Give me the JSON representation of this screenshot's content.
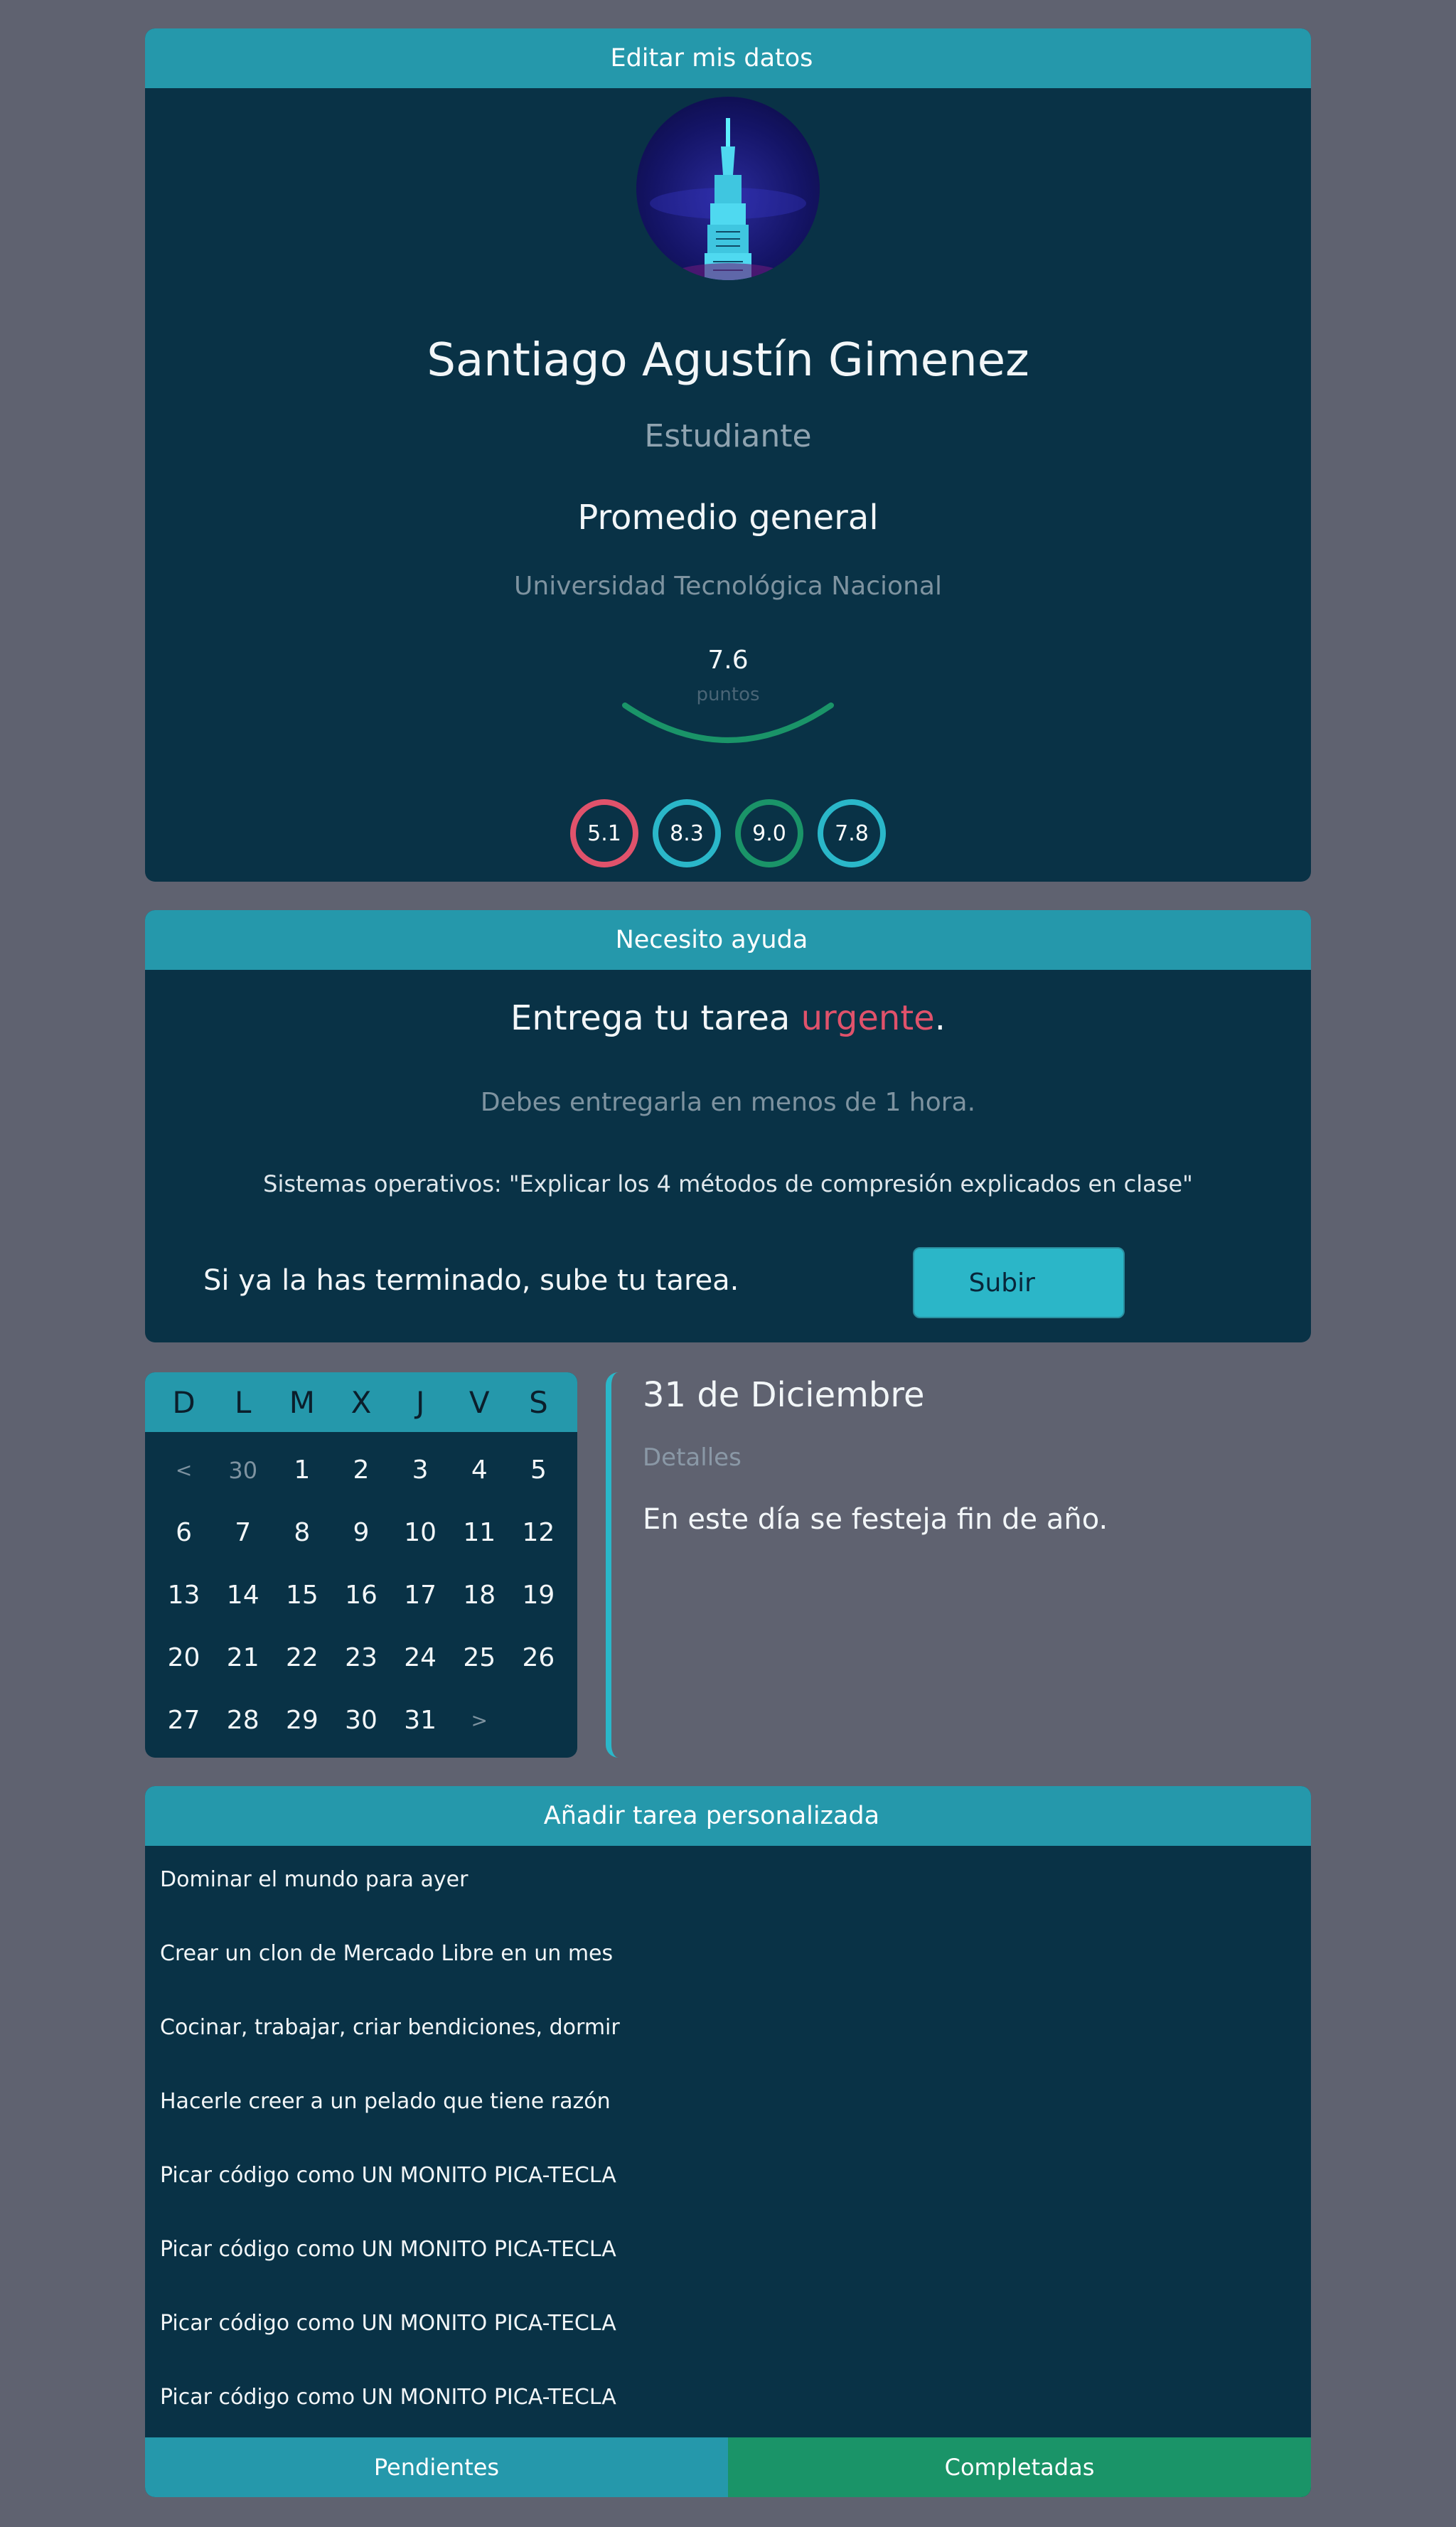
{
  "profile": {
    "header": "Editar mis datos  ",
    "name": "Santiago Agustín Gimenez",
    "role": "Estudiante",
    "average_title": "Promedio general",
    "university": "Universidad Tecnológica Nacional",
    "gauge": {
      "value": "7.6",
      "unit": "puntos",
      "color": "#1a9468"
    },
    "scores": [
      {
        "value": "5.1",
        "color": "#e0526b"
      },
      {
        "value": "8.3",
        "color": "#2ab7c9"
      },
      {
        "value": "9.0",
        "color": "#1a9468"
      },
      {
        "value": "7.8",
        "color": "#2ab7c9"
      }
    ]
  },
  "help": {
    "header": "Necesito ayuda  ",
    "title_prefix": "Entrega tu tarea ",
    "title_urgent": "urgente",
    "title_suffix": ".",
    "subtitle": "Debes entregarla en menos de 1 hora.",
    "task": "Sistemas operativos: \"Explicar los 4 métodos de compresión explicados en clase\"",
    "finish_text": "Si ya la has terminado, sube tu tarea.",
    "upload_label": "Subir  "
  },
  "calendar": {
    "weekdays": [
      "D",
      "L",
      "M",
      "X",
      "J",
      "V",
      "S"
    ],
    "prev": "<",
    "next": ">",
    "days": [
      "30",
      "1",
      "2",
      "3",
      "4",
      "5",
      "6",
      "7",
      "8",
      "9",
      "10",
      "11",
      "12",
      "13",
      "14",
      "15",
      "16",
      "17",
      "18",
      "19",
      "20",
      "21",
      "22",
      "23",
      "24",
      "25",
      "26",
      "27",
      "28",
      "29",
      "30",
      "31"
    ]
  },
  "day_detail": {
    "title": "31 de Diciembre",
    "subtitle": "Detalles",
    "text": "En este día se festeja fin de año."
  },
  "tasks": {
    "header": "Añadir tarea personalizada  ",
    "items": [
      "Dominar el mundo para ayer",
      "Crear un clon de Mercado Libre en un mes",
      "Cocinar, trabajar, criar bendiciones, dormir",
      "Hacerle creer a un pelado que tiene razón",
      "Picar código como UN MONITO PICA-TECLA",
      "Picar código como UN MONITO PICA-TECLA",
      "Picar código como UN MONITO PICA-TECLA",
      "Picar código como UN MONITO PICA-TECLA"
    ],
    "tab_pending": "Pendientes",
    "tab_completed": "Completadas"
  },
  "colors": {
    "background": "#5f6270",
    "card": "#093246",
    "header": "#2598ab",
    "accent": "#2ab7c9",
    "urgent": "#e0526b",
    "success": "#1a9468"
  }
}
